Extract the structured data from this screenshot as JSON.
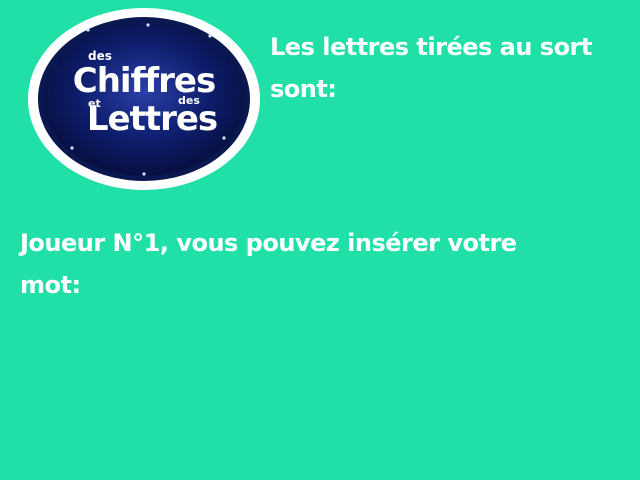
{
  "game": {
    "background_color": "#20e0a8",
    "logo": {
      "line_top": "des",
      "line_main": "Chiffres",
      "line_mid_left": "et",
      "line_mid_right": "des",
      "line_bottom": "Lettres",
      "ring_color": "#ffffff",
      "disc_color": "#0a1850"
    },
    "letters_prompt": "Les lettres tirées au sort sont:",
    "player_prompt": "Joueur N°1, vous pouvez insérer votre mot:"
  }
}
